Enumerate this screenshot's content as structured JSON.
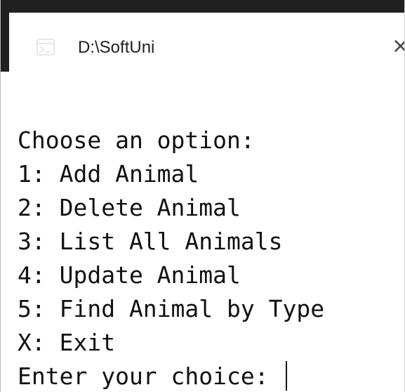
{
  "window": {
    "tab_title": "D:\\SoftUni",
    "close_glyph": "×"
  },
  "console": {
    "lines": [
      "Choose an option:",
      "1: Add Animal",
      "2: Delete Animal",
      "3: List All Animals",
      "4: Update Animal",
      "5: Find Animal by Type",
      "X: Exit",
      "Enter your choice: "
    ]
  },
  "icons": {
    "tab_icon": "terminal-icon",
    "close_icon": "close-icon"
  },
  "colors": {
    "chrome_dark": "#202020",
    "background": "#ffffff",
    "text": "#111111"
  }
}
